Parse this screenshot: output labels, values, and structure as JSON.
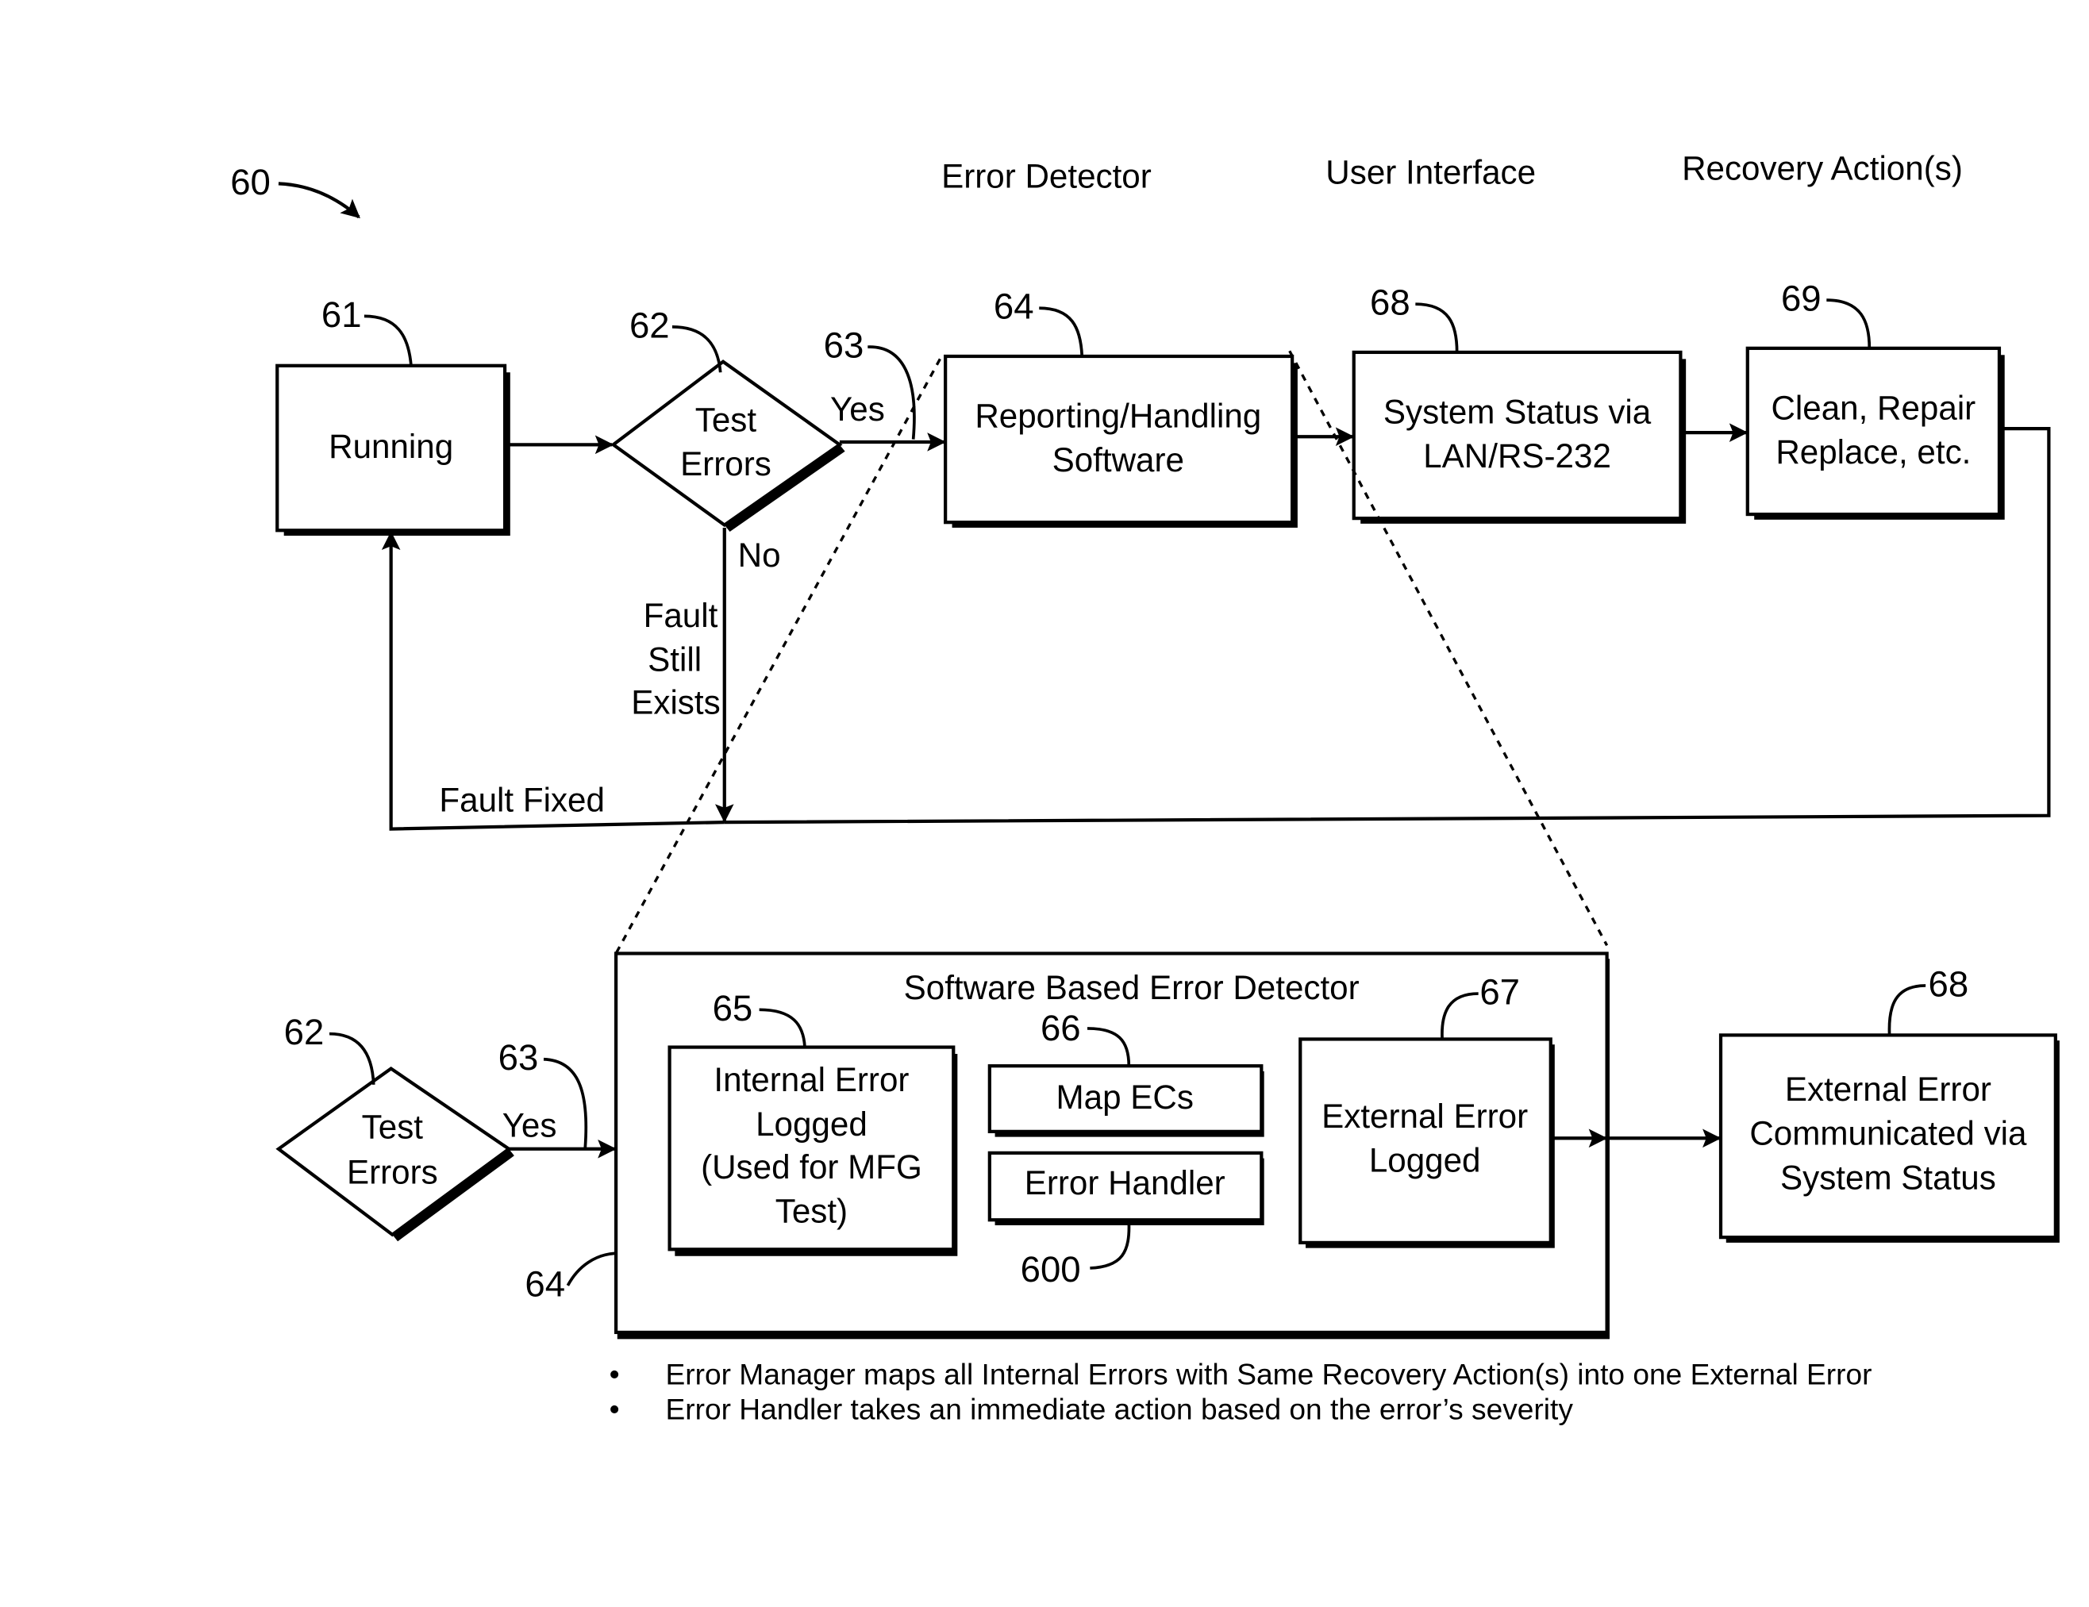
{
  "figure": {
    "ref_number": "60",
    "column_headers": {
      "error_detector": "Error Detector",
      "user_interface": "User Interface",
      "recovery_actions": "Recovery Action(s)"
    }
  },
  "top_flow": {
    "running": {
      "ref": "61",
      "label": "Running"
    },
    "test_errors": {
      "ref": "62",
      "lines": [
        "Test",
        "Errors"
      ]
    },
    "yes_path": {
      "ref": "63",
      "label": "Yes"
    },
    "no_path": {
      "label": "No",
      "condition_lines": [
        "Fault",
        "Still",
        "Exists"
      ]
    },
    "reporting": {
      "ref": "64",
      "lines": [
        "Reporting/Handling",
        "Software"
      ]
    },
    "system_status": {
      "ref": "68",
      "lines": [
        "System Status via",
        "LAN/RS-232"
      ]
    },
    "recovery": {
      "ref": "69",
      "lines": [
        "Clean, Repair",
        "Replace, etc."
      ]
    },
    "fault_fixed": "Fault Fixed"
  },
  "detail_flow": {
    "test_errors": {
      "ref": "62",
      "lines": [
        "Test",
        "Errors"
      ]
    },
    "yes_path": {
      "ref": "63",
      "label": "Yes"
    },
    "container": {
      "ref": "64",
      "title": "Software Based Error Detector"
    },
    "internal_error": {
      "ref": "65",
      "lines": [
        "Internal Error",
        "Logged",
        "(Used for MFG",
        "Test)"
      ]
    },
    "map_ecs": {
      "ref": "66",
      "label": "Map ECs"
    },
    "error_handler": {
      "ref": "600",
      "label": "Error Handler"
    },
    "external_error_logged": {
      "ref": "67",
      "lines": [
        "External Error",
        "Logged"
      ]
    },
    "external_error_communicated": {
      "ref": "68",
      "lines": [
        "External Error",
        "Communicated via",
        "System Status"
      ]
    }
  },
  "notes": [
    "Error Manager maps all Internal Errors with Same Recovery Action(s) into one External Error",
    "Error Handler takes an immediate action based on the error’s severity"
  ],
  "bullet_glyph": "•"
}
